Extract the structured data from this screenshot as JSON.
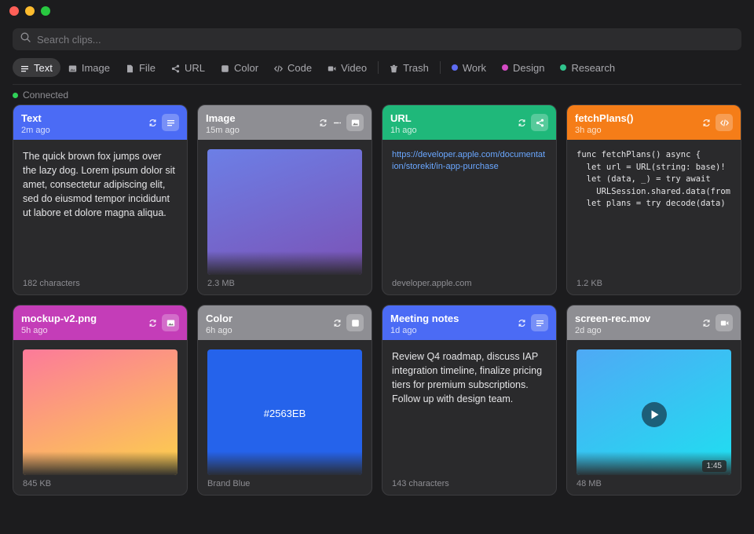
{
  "window": {
    "controls": [
      "#ff5f57",
      "#febc2e",
      "#28c840"
    ]
  },
  "search": {
    "placeholder": "Search clips...",
    "value": ""
  },
  "filters": {
    "types": [
      {
        "label": "Text",
        "icon": "lines-icon",
        "active": true
      },
      {
        "label": "Image",
        "icon": "image-icon",
        "active": false
      },
      {
        "label": "File",
        "icon": "file-icon",
        "active": false
      },
      {
        "label": "URL",
        "icon": "share-icon",
        "active": false
      },
      {
        "label": "Color",
        "icon": "square-icon",
        "active": false
      },
      {
        "label": "Code",
        "icon": "code-icon",
        "active": false
      },
      {
        "label": "Video",
        "icon": "video-icon",
        "active": false
      }
    ],
    "trash": {
      "label": "Trash",
      "icon": "trash-icon"
    },
    "tags": [
      {
        "label": "Work",
        "color": "#5e6cf2"
      },
      {
        "label": "Design",
        "color": "#d44bc4"
      },
      {
        "label": "Research",
        "color": "#30c48d"
      }
    ]
  },
  "status": {
    "label": "Connected",
    "color": "#30d158"
  },
  "cards": [
    {
      "title": "Text",
      "time": "2m ago",
      "color": "#4b6bf5",
      "type": "text",
      "type_icon": "lines-icon",
      "content": "The quick brown fox jumps over the lazy dog. Lorem ipsum dolor sit amet, consectetur adipiscing elit, sed do eiusmod tempor incididunt ut labore et dolore magna aliqua.",
      "footer": "182 characters"
    },
    {
      "title": "Image",
      "time": "15m ago",
      "color": "#8e8e93",
      "type": "image",
      "type_icon": "image-icon",
      "extra_icon": "dash-icon",
      "gradient": [
        "#6c7fe6",
        "#7b52b6"
      ],
      "footer": "2.3 MB"
    },
    {
      "title": "URL",
      "time": "1h ago",
      "color": "#1fb87a",
      "type": "url",
      "type_icon": "share-icon",
      "content": "https://developer.apple.com/documentation/storekit/in-app-purchase",
      "footer": "developer.apple.com"
    },
    {
      "title": "fetchPlans()",
      "time": "3h ago",
      "color": "#f57d18",
      "type": "code",
      "type_icon": "code-icon",
      "content": "func fetchPlans() async {\n  let url = URL(string: base)!\n  let (data, _) = try await\n    URLSession.shared.data(from\n  let plans = try decode(data)",
      "footer": "1.2 KB"
    },
    {
      "title": "mockup-v2.png",
      "time": "5h ago",
      "color": "#c43db8",
      "type": "image",
      "type_icon": "image-icon",
      "gradient": [
        "#fc7a9a",
        "#fcd24a"
      ],
      "footer": "845 KB"
    },
    {
      "title": "Color",
      "time": "6h ago",
      "color": "#8e8e93",
      "type": "color",
      "type_icon": "square-icon",
      "swatch": "#2563EB",
      "hex": "#2563EB",
      "footer": "Brand Blue"
    },
    {
      "title": "Meeting notes",
      "time": "1d ago",
      "color": "#4b6bf5",
      "type": "text",
      "type_icon": "lines-icon",
      "content": "Review Q4 roadmap, discuss IAP integration timeline, finalize pricing tiers for premium subscriptions. Follow up with design team.",
      "footer": "143 characters"
    },
    {
      "title": "screen-rec.mov",
      "time": "2d ago",
      "color": "#8e8e93",
      "type": "video",
      "type_icon": "video-icon",
      "gradient": [
        "#4fa9f5",
        "#1ee0f0"
      ],
      "duration": "1:45",
      "footer": "48 MB"
    }
  ]
}
